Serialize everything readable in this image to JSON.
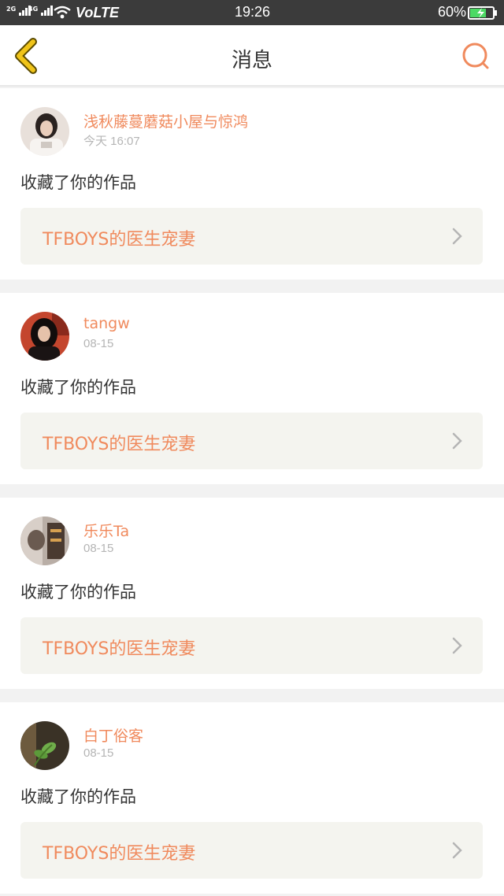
{
  "status": {
    "signal1": "2G",
    "signal2": "4G",
    "network": "VoLTE",
    "time": "19:26",
    "battery": "60%"
  },
  "header": {
    "title": "消息"
  },
  "messages": [
    {
      "user": "浅秋藤蔓蘑菇小屋与惊鸿",
      "time": "今天 16:07",
      "action": "收藏了你的作品",
      "work": "TFBOYS的医生宠妻"
    },
    {
      "user": "tangw",
      "time": "08-15",
      "action": "收藏了你的作品",
      "work": "TFBOYS的医生宠妻"
    },
    {
      "user": "乐乐Ta",
      "time": "08-15",
      "action": "收藏了你的作品",
      "work": "TFBOYS的医生宠妻"
    },
    {
      "user": "白丁俗客",
      "time": "08-15",
      "action": "收藏了你的作品",
      "work": "TFBOYS的医生宠妻"
    }
  ],
  "colors": {
    "accent": "#f08a5d",
    "back_arrow": "#f0c419",
    "card_bg": "#f4f4ef"
  }
}
